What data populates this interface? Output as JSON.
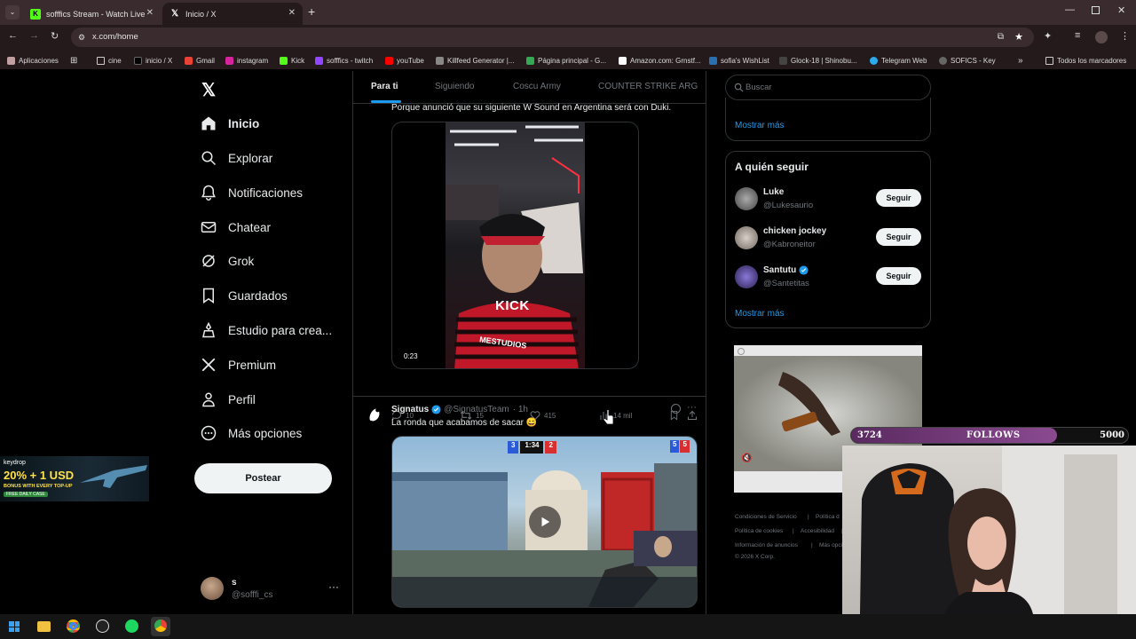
{
  "browser": {
    "tabs": [
      {
        "title": "sofffics Stream - Watch Live on",
        "favicon": "kick-icon"
      },
      {
        "title": "Inicio / X",
        "favicon": "x-icon"
      }
    ],
    "url": "x.com/home",
    "bookmarks": [
      "Aplicaciones",
      "cine",
      "inicio / X",
      "Gmail",
      "instagram",
      "Kick",
      "sofffics - twitch",
      "youTube",
      "Killfeed Generator |...",
      "Página principal - G...",
      "Amazon.com: Grnstf...",
      "sofia's WishList",
      "Glock-18 | Shinobu...",
      "Telegram Web",
      "SOFICS - Key",
      "Todos los marcadores"
    ]
  },
  "sidebar": {
    "items": [
      {
        "label": "Inicio",
        "icon": "home-icon"
      },
      {
        "label": "Explorar",
        "icon": "search-icon"
      },
      {
        "label": "Notificaciones",
        "icon": "bell-icon"
      },
      {
        "label": "Chatear",
        "icon": "mail-icon"
      },
      {
        "label": "Grok",
        "icon": "grok-icon"
      },
      {
        "label": "Guardados",
        "icon": "bookmark-icon"
      },
      {
        "label": "Estudio para crea...",
        "icon": "studio-icon"
      },
      {
        "label": "Premium",
        "icon": "x-icon"
      },
      {
        "label": "Perfil",
        "icon": "person-icon"
      },
      {
        "label": "Más opciones",
        "icon": "more-circle-icon"
      }
    ],
    "post_button": "Postear",
    "account": {
      "name": "s",
      "handle": "@sofffi_cs"
    }
  },
  "feed": {
    "tabs": [
      "Para ti",
      "Siguiendo",
      "Coscu Army",
      "COUNTER STRIKE ARG"
    ],
    "post1": {
      "text": "Porque anunció que su siguiente W Sound en Argentina será con Duki.",
      "video_time": "0:23",
      "video_overlay": "KICK",
      "shirt_text": "MESTUDIOS",
      "replies": "10",
      "reposts": "15",
      "likes": "415",
      "views": "14 mil"
    },
    "post2": {
      "name": "Signatus",
      "handle": "@SignatusTeam",
      "time": "· 1h",
      "text": "La ronda que acabamos de sacar 😄",
      "hud_time": "1:34",
      "hud_left": "3",
      "hud_right": "2",
      "hud_score_a": "5",
      "hud_score_b": "5"
    }
  },
  "right": {
    "search_placeholder": "Buscar",
    "show_more_1": "Mostrar más",
    "who_title": "A quién seguir",
    "who": [
      {
        "name": "Luke",
        "handle": "@Lukesaurio",
        "button": "Seguir"
      },
      {
        "name": "chicken jockey",
        "handle": "@Kabroneitor",
        "button": "Seguir"
      },
      {
        "name": "Santutu",
        "handle": "@Santetitas",
        "button": "Seguir"
      }
    ],
    "show_more_2": "Mostrar más",
    "footer": [
      "Condiciones de Servicio",
      "|",
      "Política d",
      "Política de cookies",
      "|",
      "Accesibilidad",
      "|",
      "Información de anuncios",
      "|",
      "Más opci",
      "© 2026 X Corp."
    ]
  },
  "overlays": {
    "follows_current": "3724",
    "follows_label": "FOLLOWS",
    "follows_goal": "5000",
    "follows_progress": 0.745,
    "keydrop_brand": "keydrop",
    "keydrop_promo": "20% + 1 USD",
    "keydrop_sub": "BONUS WITH EVERY TOP-UP",
    "keydrop_badge": "FREE DAILY CASE"
  },
  "colors": {
    "accent": "#1d9bf0",
    "background": "#000000",
    "border": "#2f3336",
    "follows_bar": "#7a3a80"
  }
}
